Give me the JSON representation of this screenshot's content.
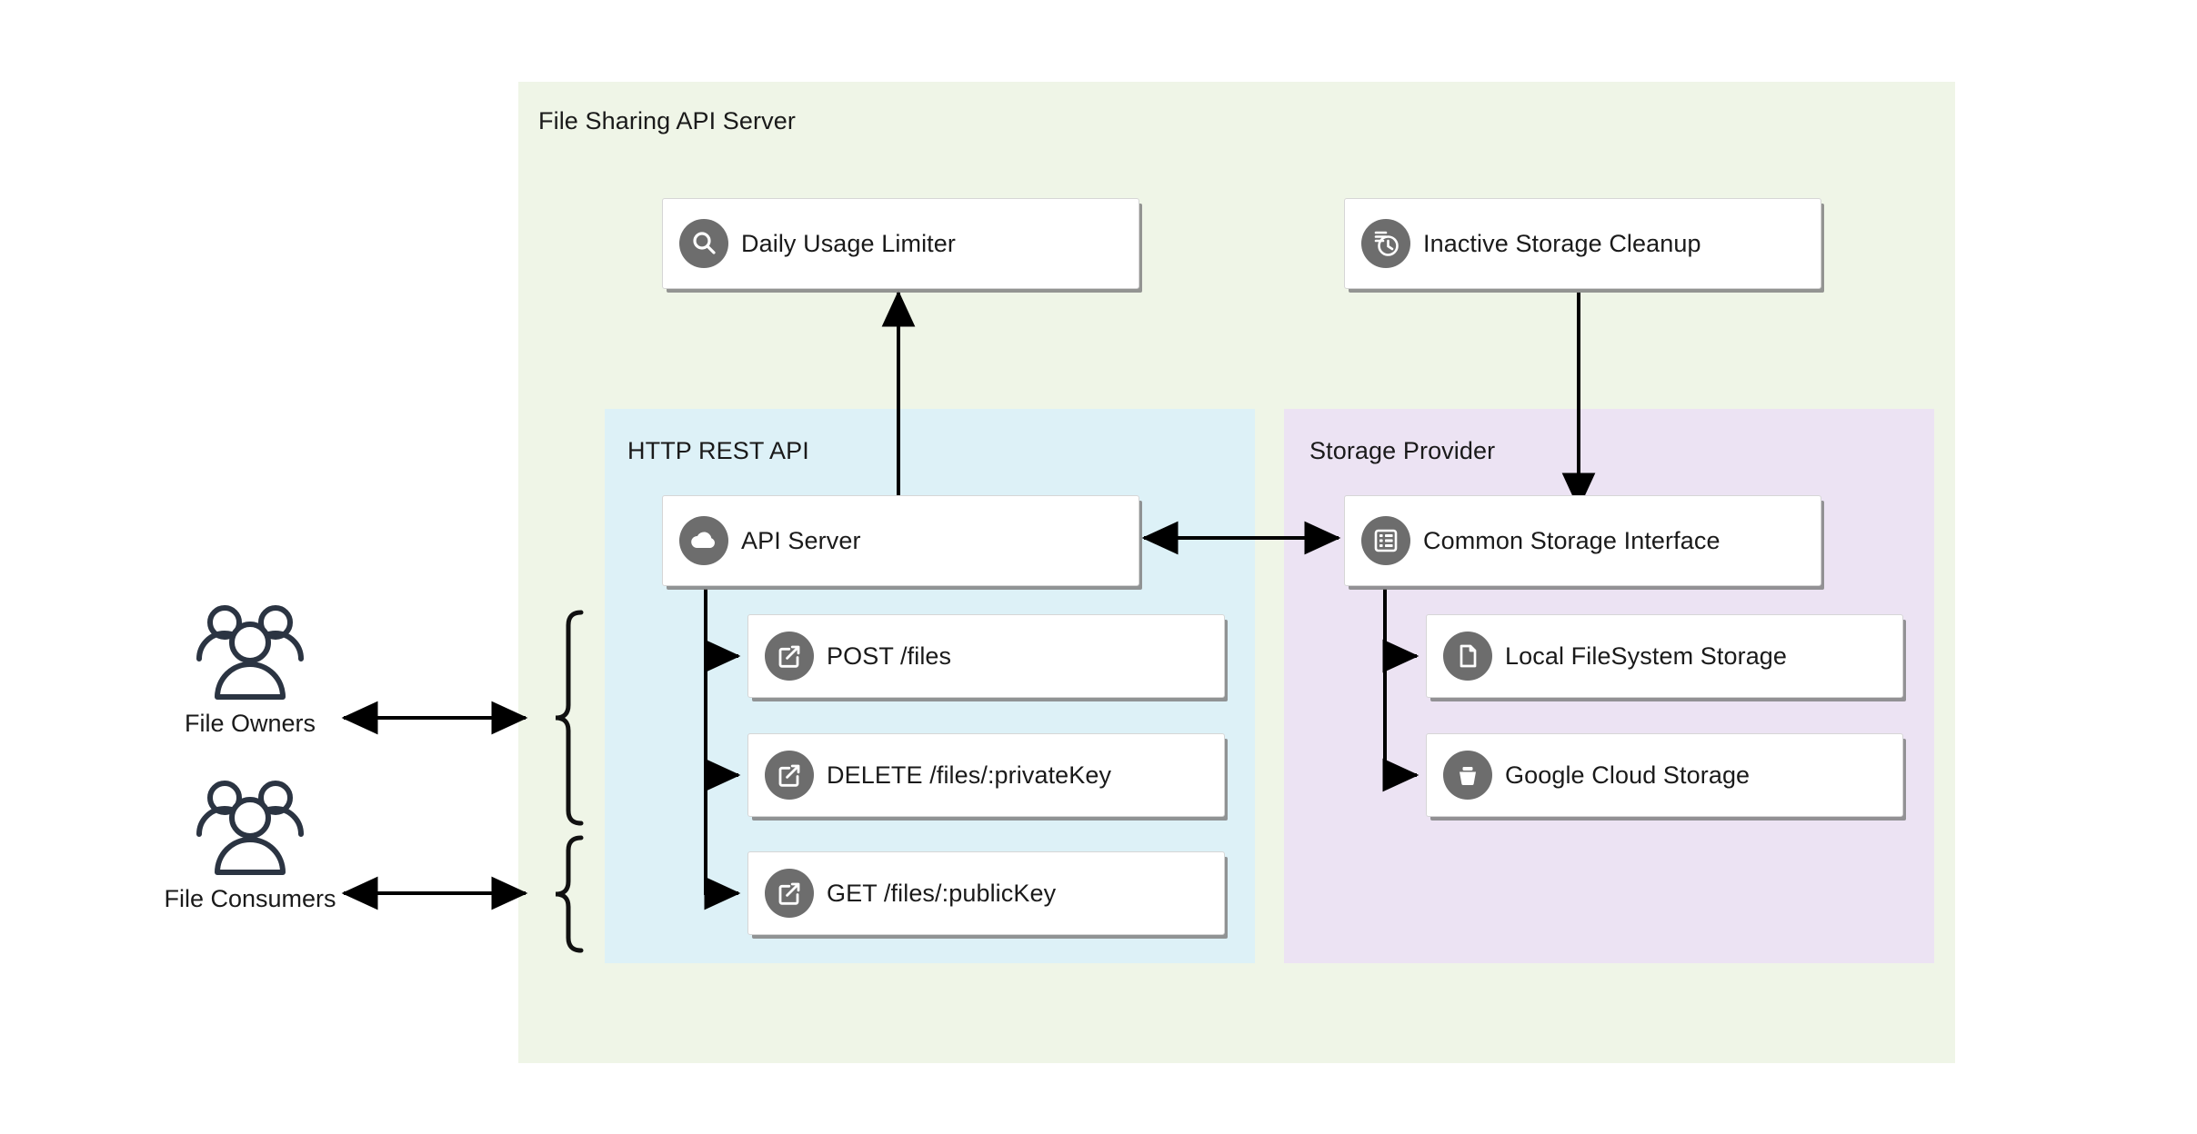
{
  "diagram": {
    "title": "File Sharing API Server",
    "background_color": "#eff5e7"
  },
  "panels": [
    {
      "id": "http_rest_api",
      "title": "HTTP REST API",
      "color": "#ddf1f7"
    },
    {
      "id": "storage_provider",
      "title": "Storage Provider",
      "color": "#ece3f3"
    }
  ],
  "actors": [
    {
      "id": "file_owners",
      "label": "File Owners",
      "icon": "users-group-icon"
    },
    {
      "id": "file_consumers",
      "label": "File Consumers",
      "icon": "users-group-icon"
    }
  ],
  "nodes": {
    "daily_usage_limiter": {
      "label": "Daily Usage Limiter",
      "icon": "search-icon"
    },
    "inactive_storage_cleanup": {
      "label": "Inactive Storage Cleanup",
      "icon": "history-clock-icon"
    },
    "api_server": {
      "label": "API Server",
      "icon": "cloud-icon"
    },
    "common_storage_interface": {
      "label": "Common Storage Interface",
      "icon": "list-icon"
    },
    "post_files": {
      "label": "POST /files",
      "icon": "external-link-icon"
    },
    "delete_files_private_key": {
      "label": "DELETE /files/:privateKey",
      "icon": "external-link-icon"
    },
    "get_files_public_key": {
      "label": "GET /files/:publicKey",
      "icon": "external-link-icon"
    },
    "local_filesystem_storage": {
      "label": "Local FileSystem Storage",
      "icon": "document-icon"
    },
    "google_cloud_storage": {
      "label": "Google Cloud Storage",
      "icon": "bucket-icon"
    }
  },
  "colors": {
    "outer_panel": "#eff5e7",
    "rest_panel": "#ddf1f7",
    "storage_panel": "#ece3f3",
    "card_bg": "#ffffff",
    "icon_circle": "#6d6d6d",
    "text": "#1a1a1a",
    "connector": "#000000",
    "actor_stroke": "#2b3442"
  }
}
